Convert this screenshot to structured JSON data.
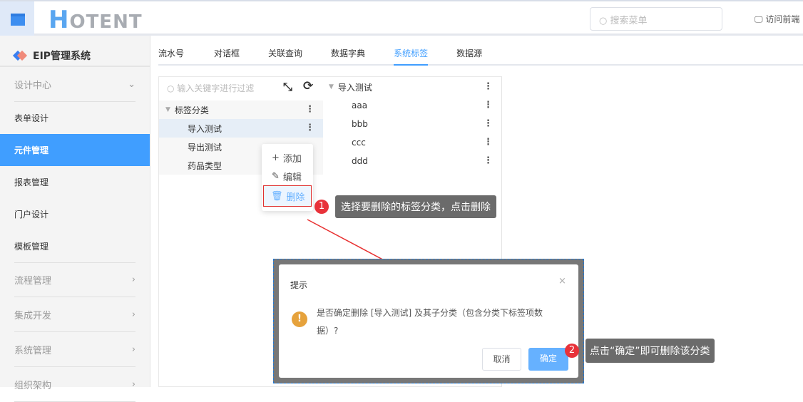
{
  "header": {
    "logo": "HOTENT",
    "search_placeholder": "搜索菜单",
    "visit_frontend": "访问前端"
  },
  "sidebar": {
    "system": "EIP管理系统",
    "groups": [
      {
        "label": "设计中心"
      },
      {
        "label": "流程管理"
      },
      {
        "label": "集成开发"
      },
      {
        "label": "系统管理"
      },
      {
        "label": "组织架构"
      }
    ],
    "items": [
      {
        "label": "表单设计"
      },
      {
        "label": "元件管理"
      },
      {
        "label": "报表管理"
      },
      {
        "label": "门户设计"
      },
      {
        "label": "模板管理"
      }
    ]
  },
  "tabs": [
    {
      "label": "流水号"
    },
    {
      "label": "对话框"
    },
    {
      "label": "关联查询"
    },
    {
      "label": "数据字典"
    },
    {
      "label": "系统标签"
    },
    {
      "label": "数据源"
    }
  ],
  "tree": {
    "filter_placeholder": "输入关键字进行过滤",
    "root": "标签分类",
    "children": [
      "导入测试",
      "导出测试",
      "药品类型"
    ]
  },
  "tags": {
    "group": "导入测试",
    "items": [
      "aaa",
      "bbb",
      "ccc",
      "ddd"
    ]
  },
  "context_menu": {
    "add": "添加",
    "edit": "编辑",
    "delete": "删除"
  },
  "annotations": [
    {
      "num": "1",
      "text": "选择要删除的标签分类，点击删除"
    },
    {
      "num": "2",
      "text": "点击“确定”即可删除该分类"
    }
  ],
  "dialog": {
    "title": "提示",
    "message": "是否确定删除 [导入测试] 及其子分类（包含分类下标签项数据）?",
    "cancel": "取消",
    "confirm": "确定"
  }
}
